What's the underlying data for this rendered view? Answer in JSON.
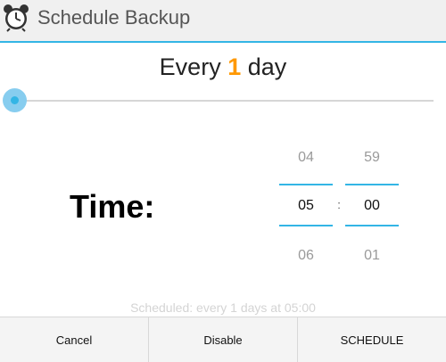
{
  "dialog": {
    "title": "Schedule Backup",
    "icon": "alarm-clock-icon"
  },
  "frequency": {
    "prefix": "Every",
    "value": "1",
    "unit": "day"
  },
  "slider": {
    "level": 0
  },
  "time": {
    "label": "Time:",
    "hour": {
      "prev": "04",
      "selected": "05",
      "next": "06"
    },
    "minute": {
      "prev": "59",
      "selected": "00",
      "next": "01"
    },
    "separator": ":"
  },
  "status": "Scheduled: every 1 days at 05:00",
  "buttons": {
    "cancel": "Cancel",
    "disable": "Disable",
    "schedule": "SCHEDULE"
  },
  "colors": {
    "accent": "#33b5e5",
    "highlight": "#ff9800"
  }
}
